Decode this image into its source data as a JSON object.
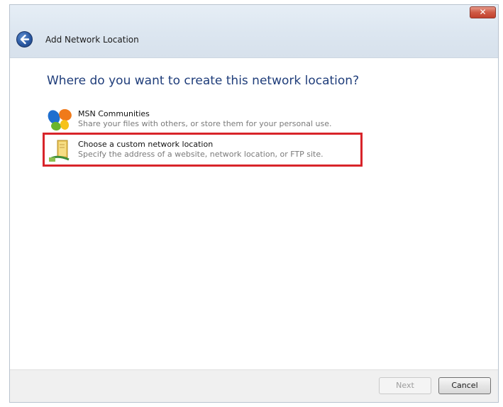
{
  "window": {
    "title": "Add Network Location",
    "close_label": "✕"
  },
  "main": {
    "heading": "Where do you want to create this network location?",
    "options": [
      {
        "title": "MSN Communities",
        "description": "Share your files with others, or store them for your personal use.",
        "icon": "msn-butterfly-icon"
      },
      {
        "title": "Choose a custom network location",
        "description": "Specify the address of a website, network location, or FTP site.",
        "icon": "network-folder-icon",
        "highlighted": true
      }
    ]
  },
  "footer": {
    "next_label": "Next",
    "cancel_label": "Cancel",
    "next_enabled": false
  },
  "colors": {
    "heading": "#1f3d7a",
    "highlight": "#d8242a",
    "titlebar": "#dce6f0"
  }
}
